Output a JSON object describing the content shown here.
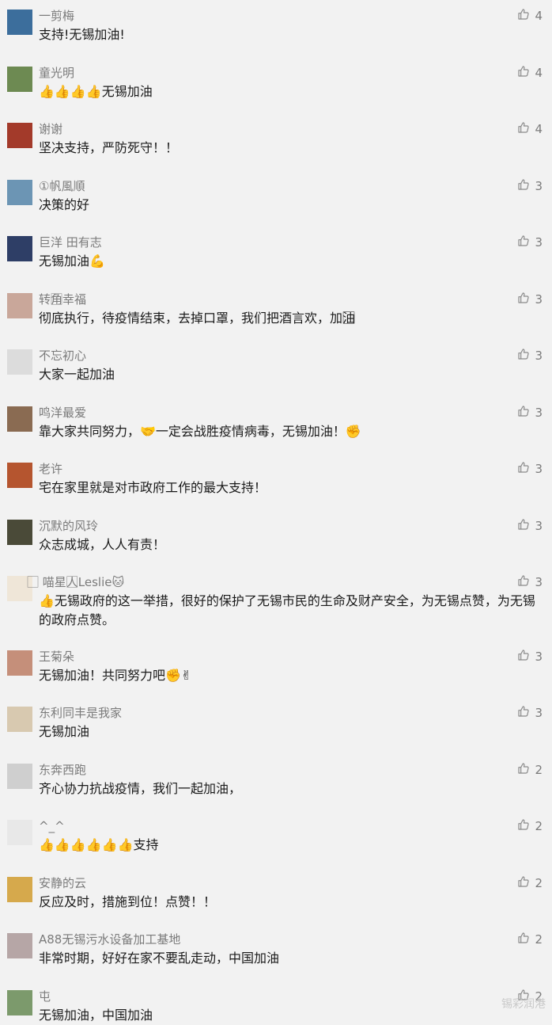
{
  "comments": [
    {
      "user": "一剪梅",
      "text": "支持!无锡加油!",
      "likes": "4"
    },
    {
      "user": "童光明",
      "text": "👍👍👍👍无锡加油",
      "likes": "4"
    },
    {
      "user": "谢谢",
      "text": "坚决支持，严防死守！！",
      "likes": "4"
    },
    {
      "user": "①帆風順",
      "text": "决策的好",
      "likes": "3"
    },
    {
      "user": "巨洋 田有志",
      "text": "无锡加油💪",
      "likes": "3"
    },
    {
      "user": "转角⃞幸福",
      "text": "彻底执行，待疫情结束，去掉口罩，我们把酒言欢，加油⃞",
      "likes": "3"
    },
    {
      "user": "不忘初心",
      "text": "大家一起加油",
      "likes": "3"
    },
    {
      "user": "鸣洋最爱",
      "text": "靠大家共同努力，🤝一定会战胜疫情病毒，无锡加油！✊",
      "likes": "3"
    },
    {
      "user": "老许",
      "text": "宅在家里就是对市政府工作的最大支持！",
      "likes": "3"
    },
    {
      "user": "沉默的风玲",
      "text": "众志成城，人人有责！",
      "likes": "3"
    },
    {
      "user": "⃞ 喵星人⃞⃞Leslie🐱",
      "text": "👍无锡政府的这一举措，很好的保护了无锡市民的生命及财产安全，为无锡点赞，为无锡的政府点赞。",
      "likes": "3"
    },
    {
      "user": "王菊朵",
      "text": "无锡加油！共同努力吧✊✌",
      "likes": "3"
    },
    {
      "user": "东利同丰是我家",
      "text": "无锡加油",
      "likes": "3"
    },
    {
      "user": "东奔西跑",
      "text": "齐心协力抗战疫情，我们一起加油，",
      "likes": "2"
    },
    {
      "user": "^_^",
      "text": "👍👍👍👍👍👍支持",
      "likes": "2"
    },
    {
      "user": "安静的云",
      "text": "反应及时，措施到位！点赞！！",
      "likes": "2"
    },
    {
      "user": "A88无锡污水设备加工基地",
      "text": "非常时期，好好在家不要乱走动，中国加油",
      "likes": "2"
    },
    {
      "user": "屯",
      "text": "无锡加油，中国加油",
      "likes": "2"
    }
  ],
  "avatar_colors": [
    "#3c6e9c",
    "#6d8a52",
    "#a33a2a",
    "#6c95b4",
    "#2e3e66",
    "#c9a79a",
    "#dcdcdc",
    "#8a6b52",
    "#b5552f",
    "#4a4a38",
    "#efe6d8",
    "#c58f7a",
    "#d8c9b0",
    "#cfcfcf",
    "#e8e8e8",
    "#d6a94c",
    "#b6a6a6",
    "#7c9a6c"
  ],
  "like_icon": "thumbs-up-icon",
  "watermark": "锡彩润港"
}
